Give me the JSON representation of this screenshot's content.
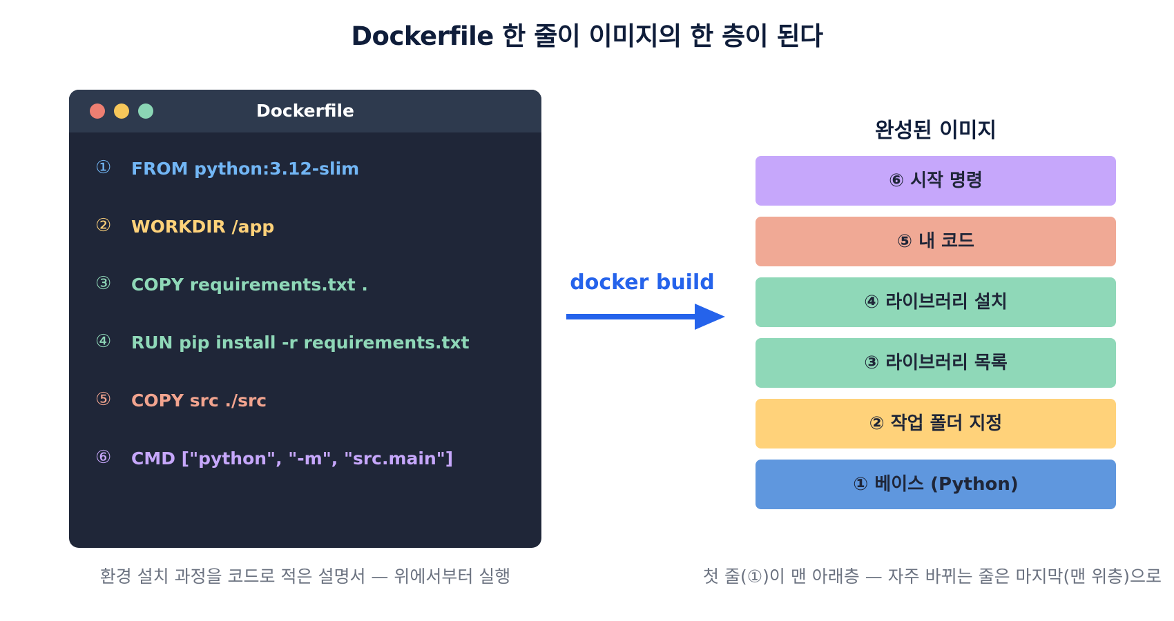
{
  "title": "Dockerfile 한 줄이 이미지의 한 층이 된다",
  "editor": {
    "window_title": "Dockerfile",
    "lines": [
      {
        "num": "①",
        "code": "FROM python:3.12-slim",
        "color": "#72b6f5"
      },
      {
        "num": "②",
        "code": "WORKDIR /app",
        "color": "#ffd27a"
      },
      {
        "num": "③",
        "code": "COPY requirements.txt .",
        "color": "#8fd8b8"
      },
      {
        "num": "④",
        "code": "RUN pip install -r requirements.txt",
        "color": "#8fd8b8"
      },
      {
        "num": "⑤",
        "code": "COPY src ./src",
        "color": "#f2a48f"
      },
      {
        "num": "⑥",
        "code": "CMD [\"python\", \"-m\", \"src.main\"]",
        "color": "#c6a7fb"
      }
    ],
    "caption": "환경 설치 과정을 코드로 적은 설명서 — 위에서부터 실행"
  },
  "arrow": {
    "label": "docker build",
    "color": "#2563eb"
  },
  "image_stack": {
    "title": "완성된 이미지",
    "layers": [
      {
        "label": "⑥ 시작 명령",
        "color": "#c6a7fb"
      },
      {
        "label": "⑤ 내 코드",
        "color": "#f0a995"
      },
      {
        "label": "④ 라이브러리 설치",
        "color": "#8fd8b8"
      },
      {
        "label": "③ 라이브러리 목록",
        "color": "#8fd8b8"
      },
      {
        "label": "② 작업 폴더 지정",
        "color": "#ffd27a"
      },
      {
        "label": "① 베이스 (Python)",
        "color": "#5f97de"
      }
    ],
    "caption": "첫 줄(①)이 맨 아래층 — 자주 바뀌는 줄은 마지막(맨 위층)으로"
  }
}
